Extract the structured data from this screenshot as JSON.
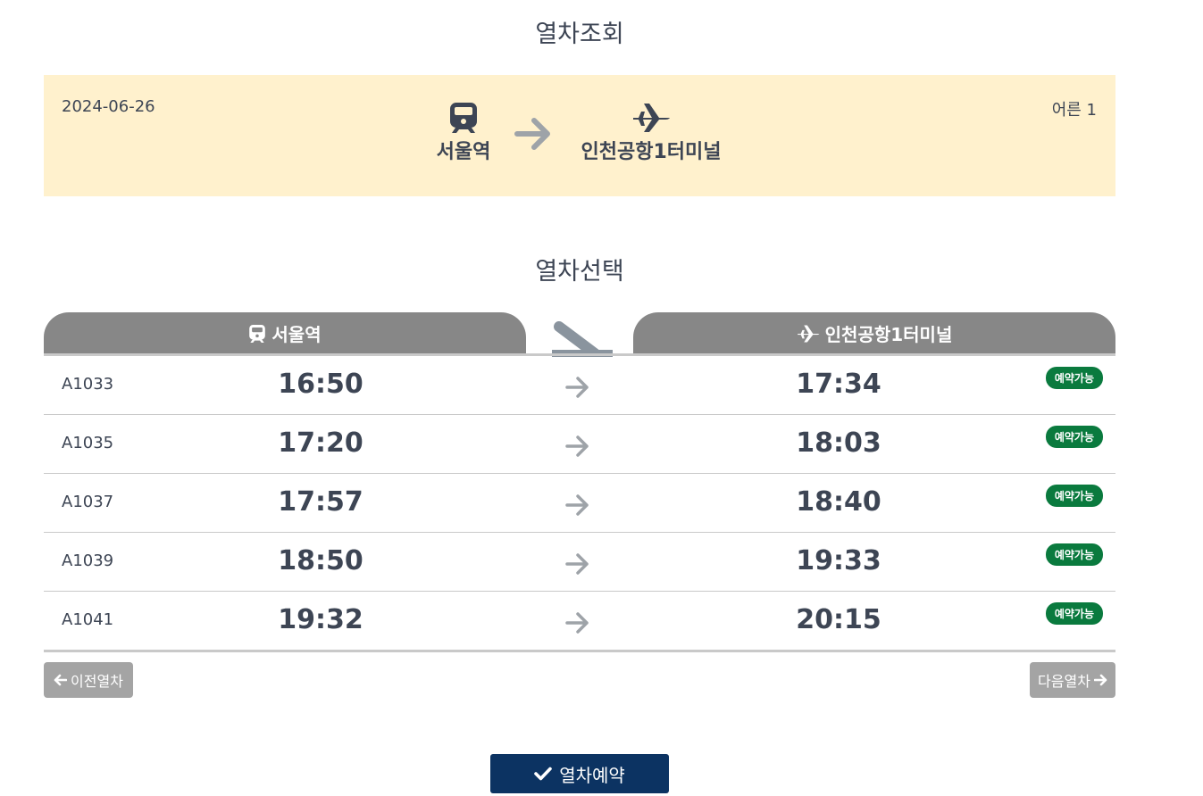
{
  "page": {
    "lookup_title": "열차조회",
    "select_title": "열차선택"
  },
  "summary": {
    "date": "2024-06-26",
    "passengers": "어른 1",
    "departure": "서울역",
    "arrival": "인천공항1터미널",
    "departure_icon": "train-icon",
    "arrival_icon": "airplane-icon",
    "bg_color": "#fff1cd"
  },
  "table_header": {
    "departure": "서울역",
    "arrival": "인천공항1터미널"
  },
  "trains": [
    {
      "no": "A1033",
      "dep": "16:50",
      "arr": "17:34",
      "status": "예약가능"
    },
    {
      "no": "A1035",
      "dep": "17:20",
      "arr": "18:03",
      "status": "예약가능"
    },
    {
      "no": "A1037",
      "dep": "17:57",
      "arr": "18:40",
      "status": "예약가능"
    },
    {
      "no": "A1039",
      "dep": "18:50",
      "arr": "19:33",
      "status": "예약가능"
    },
    {
      "no": "A1041",
      "dep": "19:32",
      "arr": "20:15",
      "status": "예약가능"
    }
  ],
  "nav": {
    "prev_label": "이전열차",
    "next_label": "다음열차"
  },
  "reserve": {
    "label": "열차예약",
    "color": "#0c3362"
  },
  "colors": {
    "status_badge": "#0a7a3e",
    "header_tab": "#878787"
  }
}
